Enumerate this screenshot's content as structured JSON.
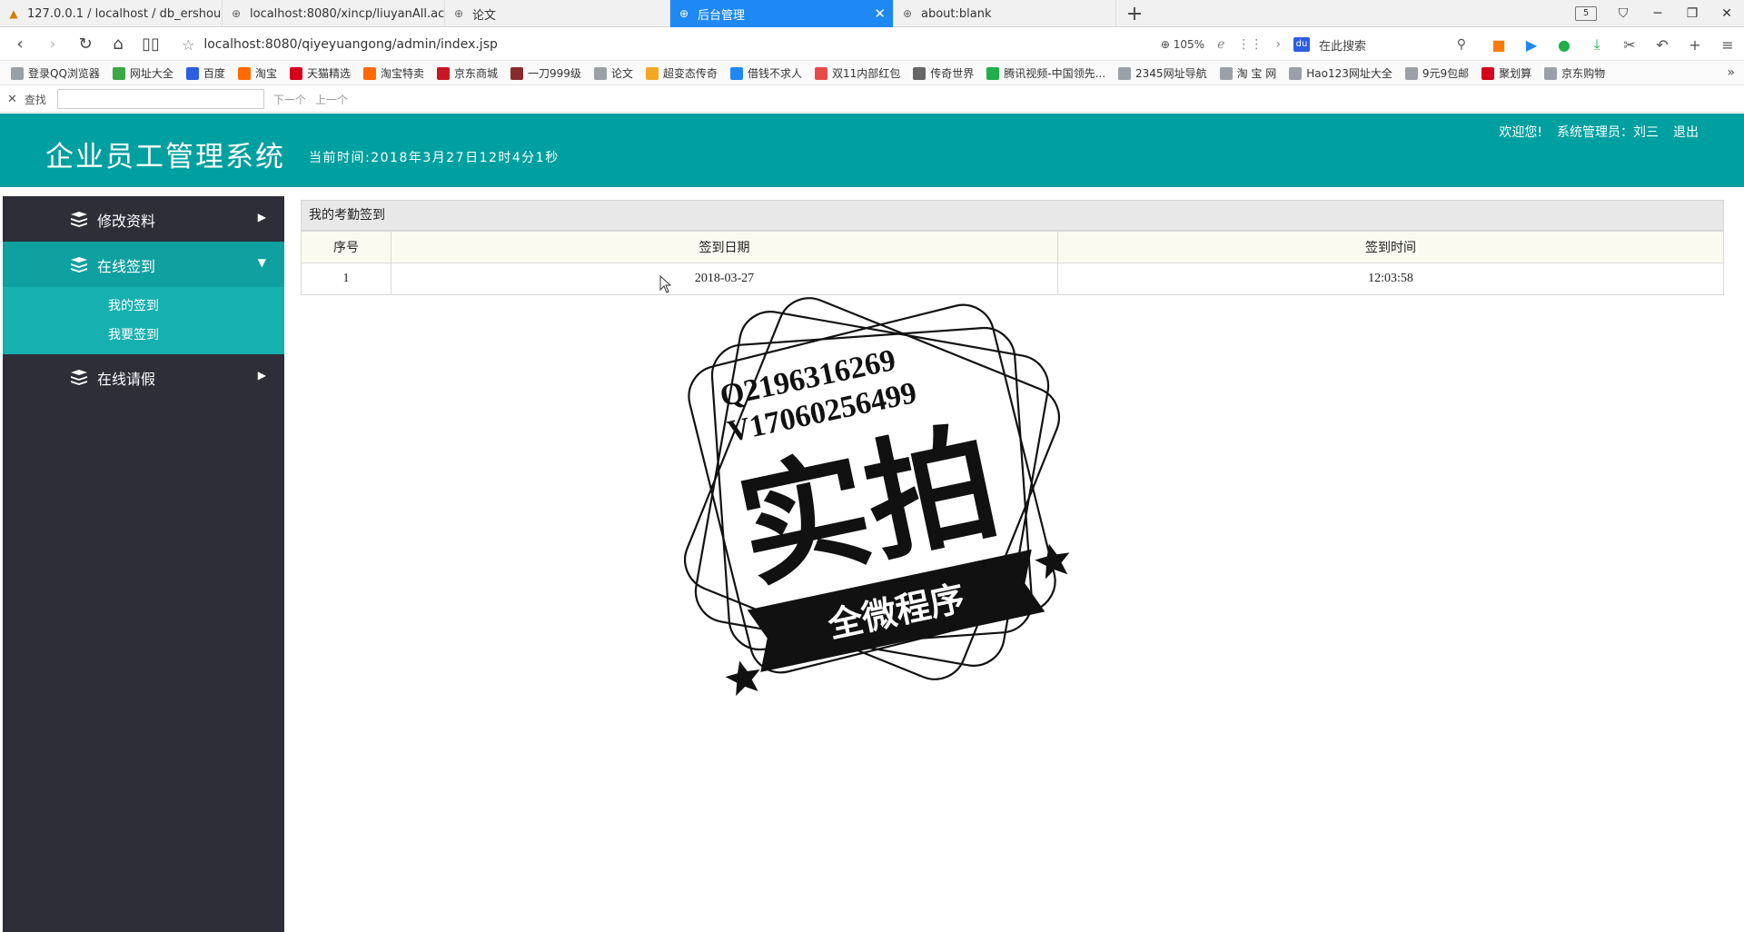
{
  "browser": {
    "tabs": [
      {
        "title": "127.0.0.1 / localhost / db_ershouch",
        "icon": "pma-icon"
      },
      {
        "title": "localhost:8080/xincp/liuyanAll.actio",
        "icon": "globe-icon"
      },
      {
        "title": "论文",
        "icon": "globe-icon"
      },
      {
        "title": "后台管理",
        "icon": "globe-icon",
        "active": true
      },
      {
        "title": "about:blank",
        "icon": "globe-icon"
      }
    ],
    "tab_count": "5",
    "url": "localhost:8080/qiyeyuangong/admin/index.jsp",
    "zoom": "105%",
    "search_placeholder": "在此搜索",
    "bookmarks": [
      {
        "label": "登录QQ浏览器",
        "color": "#9aa0a6"
      },
      {
        "label": "网址大全",
        "color": "#3aa845"
      },
      {
        "label": "百度",
        "color": "#2b5ee0"
      },
      {
        "label": "淘宝",
        "color": "#ff6a00"
      },
      {
        "label": "天猫精选",
        "color": "#d6001c"
      },
      {
        "label": "淘宝特卖",
        "color": "#ff6a00"
      },
      {
        "label": "京东商城",
        "color": "#c81623"
      },
      {
        "label": "一刀999级",
        "color": "#8a2b2b"
      },
      {
        "label": "论文",
        "color": "#9aa0a6"
      },
      {
        "label": "超变态传奇",
        "color": "#f5a623"
      },
      {
        "label": "借钱不求人",
        "color": "#1e88f4"
      },
      {
        "label": "双11内部红包",
        "color": "#e84a4a"
      },
      {
        "label": "传奇世界",
        "color": "#666666"
      },
      {
        "label": "腾讯视频-中国领先...",
        "color": "#20b04b"
      },
      {
        "label": "2345网址导航",
        "color": "#9aa0a6"
      },
      {
        "label": "淘 宝 网",
        "color": "#9aa0a6"
      },
      {
        "label": "Hao123网址大全",
        "color": "#9aa0a6"
      },
      {
        "label": "9元9包邮",
        "color": "#9aa0a6"
      },
      {
        "label": "聚划算",
        "color": "#d6001c"
      },
      {
        "label": "京东购物",
        "color": "#9aa0a6"
      }
    ],
    "find": {
      "label": "查找",
      "next": "下一个",
      "prev": "上一个"
    }
  },
  "app": {
    "title": "企业员工管理系统",
    "clock": "当前时间:2018年3月27日12时4分1秒",
    "welcome": "欢迎您!",
    "user": "系统管理员：刘三",
    "logout": "退出",
    "accent": "#00a0a0",
    "sidebar": {
      "menu": [
        {
          "label": "修改资料"
        },
        {
          "label": "在线签到",
          "open": true,
          "children": [
            {
              "label": "我的签到"
            },
            {
              "label": "我要签到"
            }
          ]
        },
        {
          "label": "在线请假"
        }
      ]
    },
    "panel_title": "我的考勤签到",
    "table": {
      "columns": [
        "序号",
        "签到日期",
        "签到时间"
      ],
      "rows": [
        [
          "1",
          "2018-03-27",
          "12:03:58"
        ]
      ]
    }
  },
  "watermark": {
    "line1": "Q2196316269",
    "line2": "V17060256499",
    "main": "实拍",
    "banner": "全微程序"
  }
}
